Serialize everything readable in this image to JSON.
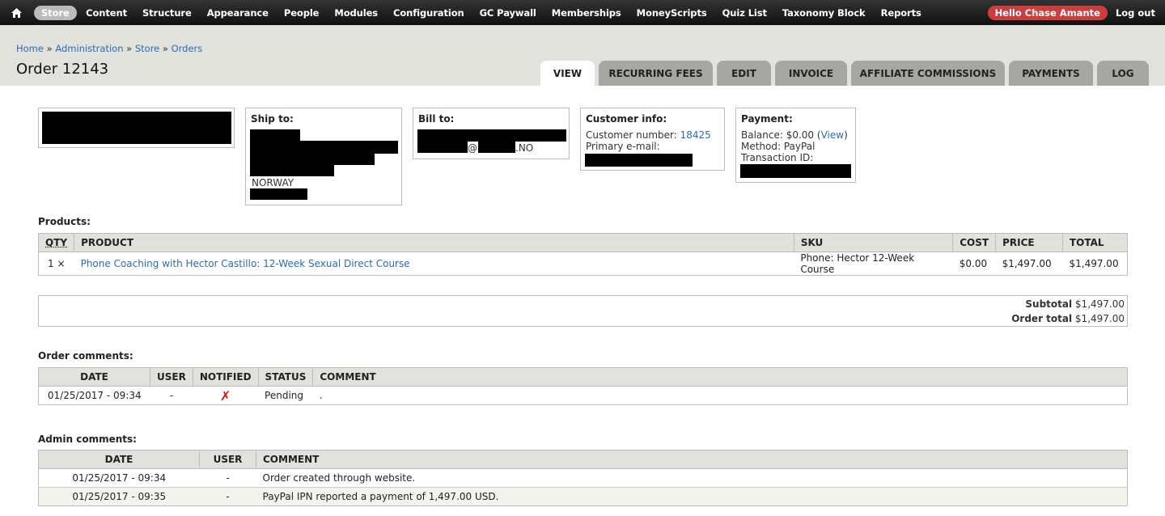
{
  "toolbar": {
    "menu": [
      "Store",
      "Content",
      "Structure",
      "Appearance",
      "People",
      "Modules",
      "Configuration",
      "GC Paywall",
      "Memberships",
      "MoneyScripts",
      "Quiz List",
      "Taxonomy Block",
      "Reports"
    ],
    "hello": "Hello Chase Amante",
    "logout": "Log out"
  },
  "breadcrumb": [
    "Home",
    "Administration",
    "Store",
    "Orders"
  ],
  "page_title": "Order 12143",
  "tabs": [
    "VIEW",
    "RECURRING FEES",
    "EDIT",
    "INVOICE",
    "AFFILIATE COMMISSIONS",
    "PAYMENTS",
    "LOG"
  ],
  "ship_to": {
    "label": "Ship to:",
    "country": "NORWAY"
  },
  "bill_to": {
    "label": "Bill to:",
    "at": "@",
    "domain": ".NO"
  },
  "customer_info": {
    "label": "Customer info:",
    "number_label": "Customer number:",
    "number": "18425",
    "email_label": "Primary e-mail:"
  },
  "payment": {
    "label": "Payment:",
    "balance": "Balance: $0.00 (",
    "view": "View",
    "balance_end": ")",
    "method": "Method: PayPal",
    "txn_label": "Transaction ID:"
  },
  "products": {
    "title": "Products:",
    "headers": [
      "QTY",
      "PRODUCT",
      "SKU",
      "COST",
      "PRICE",
      "TOTAL"
    ],
    "rows": [
      {
        "qty": "1 ×",
        "product": "Phone Coaching with Hector Castillo: 12-Week Sexual Direct Course",
        "sku": "Phone: Hector 12-Week Course",
        "cost": "$0.00",
        "price": "$1,497.00",
        "total": "$1,497.00"
      }
    ]
  },
  "totals": {
    "subtotal_label": "Subtotal",
    "subtotal": "$1,497.00",
    "order_total_label": "Order total",
    "order_total": "$1,497.00"
  },
  "order_comments": {
    "title": "Order comments:",
    "headers": [
      "DATE",
      "USER",
      "NOTIFIED",
      "STATUS",
      "COMMENT"
    ],
    "rows": [
      {
        "date": "01/25/2017 - 09:34",
        "user": "-",
        "notified": "✗",
        "status": "Pending",
        "comment": "."
      }
    ]
  },
  "admin_comments": {
    "title": "Admin comments:",
    "headers": [
      "DATE",
      "USER",
      "COMMENT"
    ],
    "rows": [
      {
        "date": "01/25/2017 - 09:34",
        "user": "-",
        "comment": "Order created through website."
      },
      {
        "date": "01/25/2017 - 09:35",
        "user": "-",
        "comment": "PayPal IPN reported a payment of 1,497.00 USD."
      }
    ]
  },
  "colors": {
    "accent_link": "#2a6ab8",
    "hello_badge": "#cc3d3d",
    "not_notified": "#dd1111"
  }
}
